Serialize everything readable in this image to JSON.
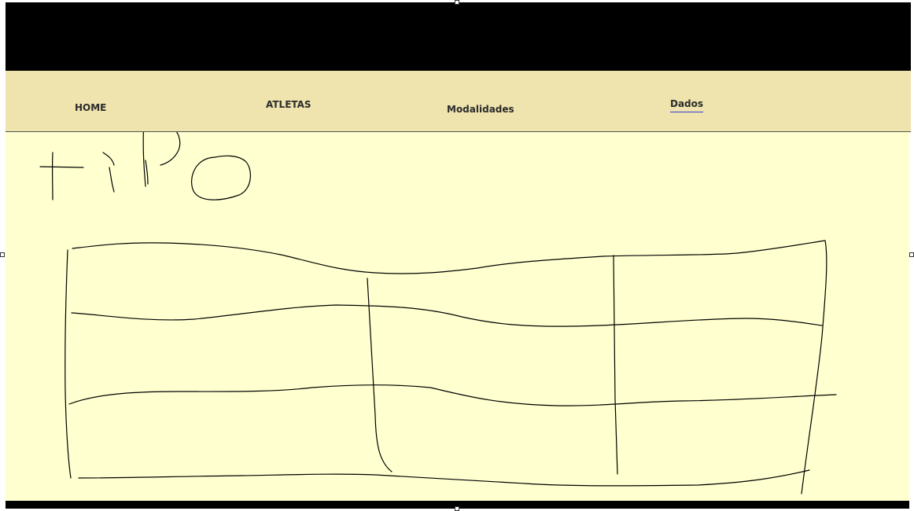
{
  "nav": {
    "items": [
      {
        "label": "HOME"
      },
      {
        "label": "ATLETAS"
      },
      {
        "label": "Modalidades"
      },
      {
        "label": "Dados",
        "active": true
      }
    ]
  },
  "sketch": {
    "handwritten_text": "TIPO"
  },
  "colors": {
    "header": "#000000",
    "nav_background": "#EFE3AE",
    "content_background": "#FFFFD0",
    "active_underline": "#3B3BD6",
    "ink": "#000000"
  }
}
